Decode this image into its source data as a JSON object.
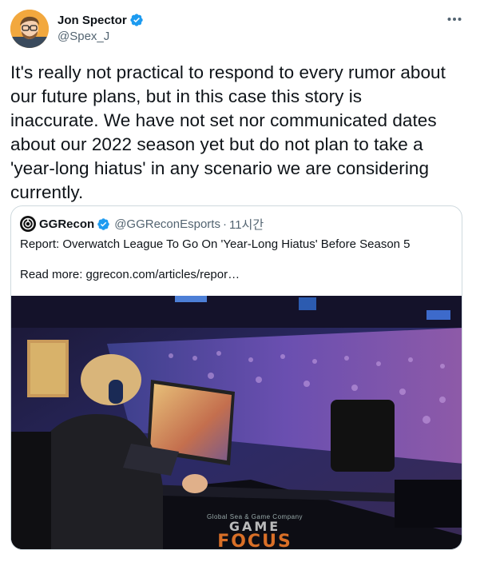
{
  "author": {
    "name": "Jon Spector",
    "handle": "@Spex_J",
    "avatar_icon": "avatar-illustration"
  },
  "tweet": {
    "text": "It's really not practical to respond to every rumor about\nour future plans, but in this case this story is\ninaccurate. We have not set nor communicated dates\nabout our 2022 season yet but do not plan to take a\n'year-long hiatus' in any scenario we are considering\ncurrently."
  },
  "quoted": {
    "name": "GGRecon",
    "handle": "@GGReconEsports",
    "separator": "·",
    "time": "11시간",
    "text": "Report: Overwatch League To Go On 'Year-Long Hiatus' Before Season 5",
    "read_more": "Read more: ggrecon.com/articles/repor…",
    "image_watermark": {
      "small": "Global Sea & Game Company",
      "line1": "GAME",
      "line2": "FOCUS"
    }
  },
  "colors": {
    "verified": "#1d9bf0",
    "text": "#0f1419",
    "muted": "#536471",
    "border": "#cfd9de"
  }
}
